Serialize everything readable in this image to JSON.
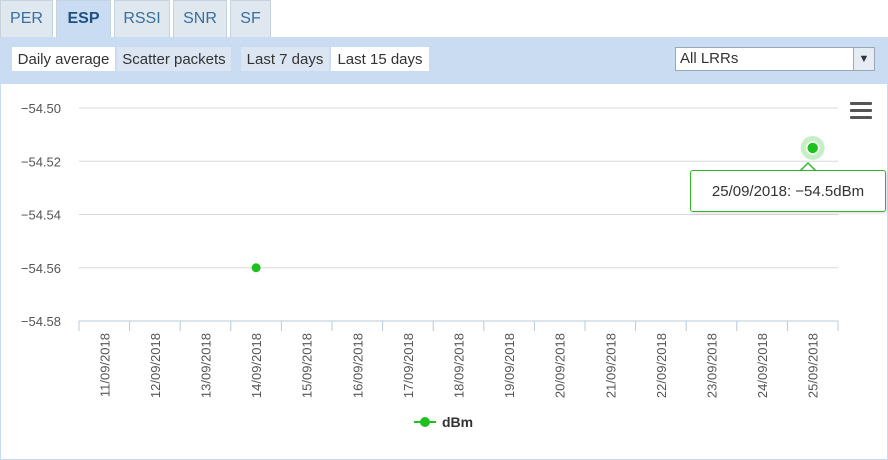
{
  "tabs": [
    {
      "label": "PER"
    },
    {
      "label": "ESP",
      "active": true
    },
    {
      "label": "RSSI"
    },
    {
      "label": "SNR"
    },
    {
      "label": "SF"
    }
  ],
  "toolbar": {
    "daily_average": "Daily average",
    "scatter_packets": "Scatter packets",
    "last_7_days": "Last 7 days",
    "last_15_days": "Last 15 days",
    "lrr_select": "All LRRs"
  },
  "tooltip": {
    "text": "25/09/2018: −54.5dBm"
  },
  "colors": {
    "series": "#1fc11f",
    "accent": "#c9dcf2",
    "tooltip_border": "#2fb52f"
  },
  "icons": {
    "menu": "hamburger-menu-icon",
    "select": "chevron-down-icon"
  },
  "chart_data": {
    "type": "scatter",
    "categories": [
      "11/09/2018",
      "12/09/2018",
      "13/09/2018",
      "14/09/2018",
      "15/09/2018",
      "16/09/2018",
      "17/09/2018",
      "18/09/2018",
      "19/09/2018",
      "20/09/2018",
      "21/09/2018",
      "22/09/2018",
      "23/09/2018",
      "24/09/2018",
      "25/09/2018"
    ],
    "yticks": [
      "−54.50",
      "−54.52",
      "−54.54",
      "−54.56",
      "−54.58"
    ],
    "yvalues": [
      -54.5,
      -54.52,
      -54.54,
      -54.56,
      -54.58
    ],
    "ylim": [
      -54.58,
      -54.5
    ],
    "series": [
      {
        "name": "dBm",
        "points": [
          {
            "x": "14/09/2018",
            "y": -54.56
          },
          {
            "x": "25/09/2018",
            "y": -54.515,
            "highlighted": true
          }
        ]
      }
    ],
    "grid": true,
    "legend": "bottom-center"
  }
}
